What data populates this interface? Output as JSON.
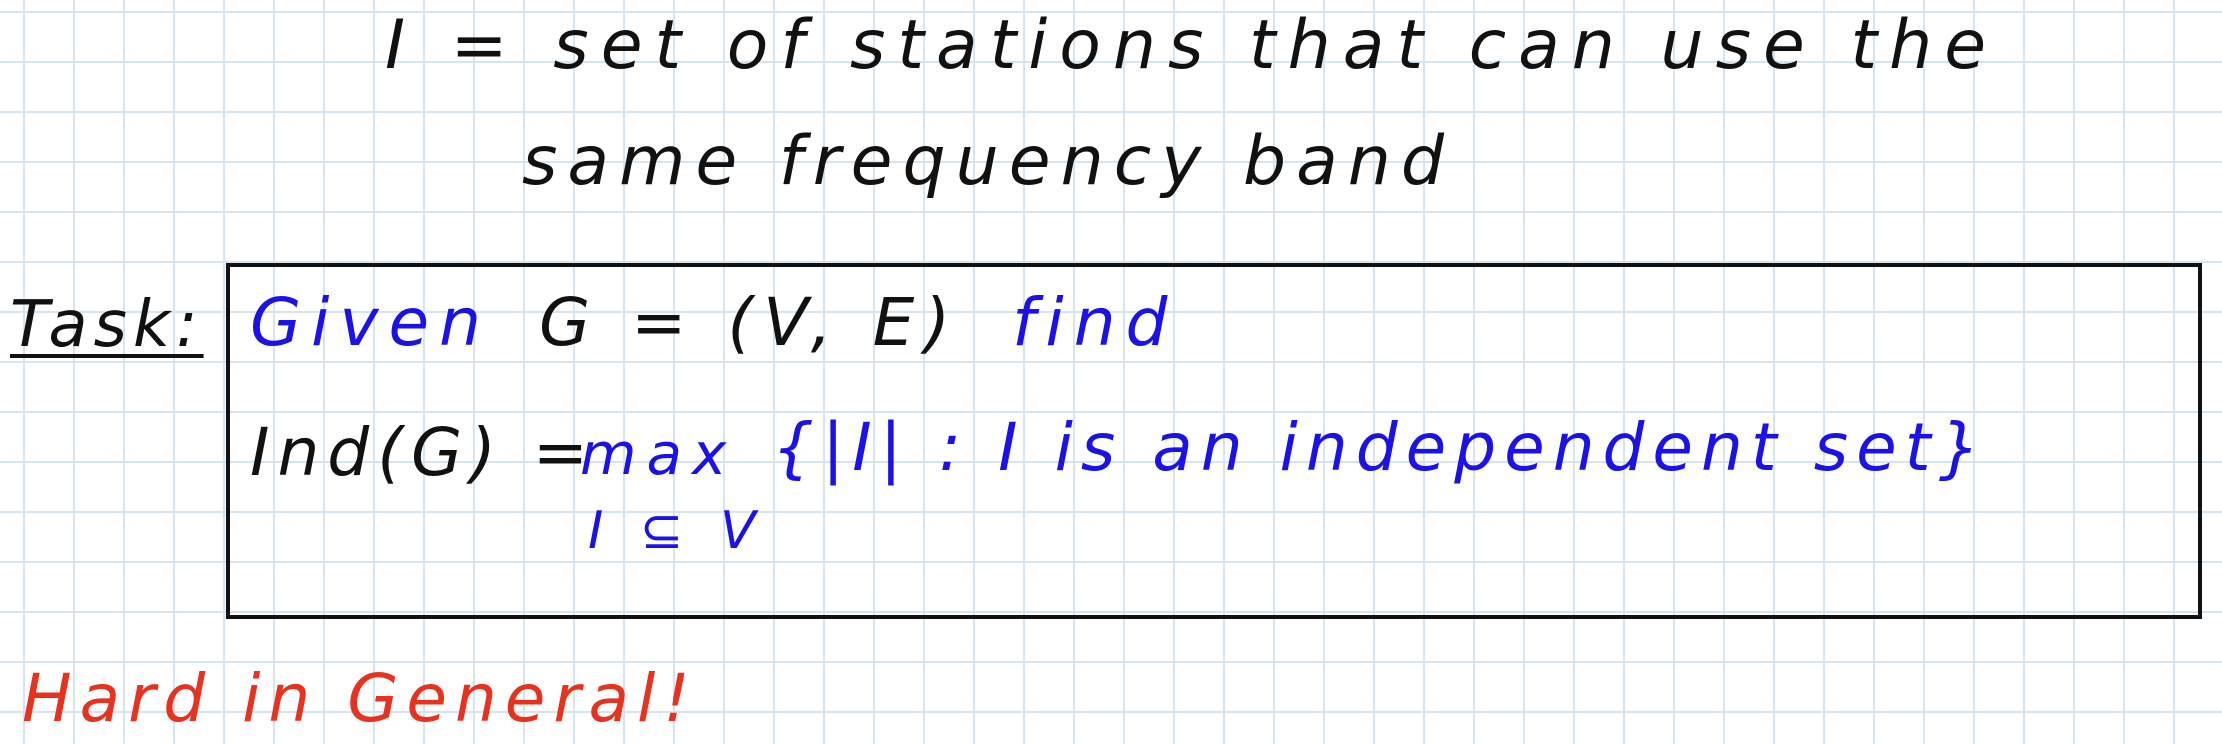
{
  "definition": {
    "line1": "I = set of stations that can use the",
    "line2": "same frequency band"
  },
  "task": {
    "label": "Task:",
    "given_word": "Given",
    "graph": "G = (V, E)",
    "find_word": "find",
    "lhs": "Ind(G) =",
    "operator": "max",
    "subscript": "I ⊆ V",
    "set_expression": "{|I| : I is an independent set}"
  },
  "note": "Hard in General!",
  "colors": {
    "black_ink": "#111111",
    "blue_ink": "#1a12e8",
    "red_ink": "#e8321e",
    "grid": "#d6e4f0"
  }
}
